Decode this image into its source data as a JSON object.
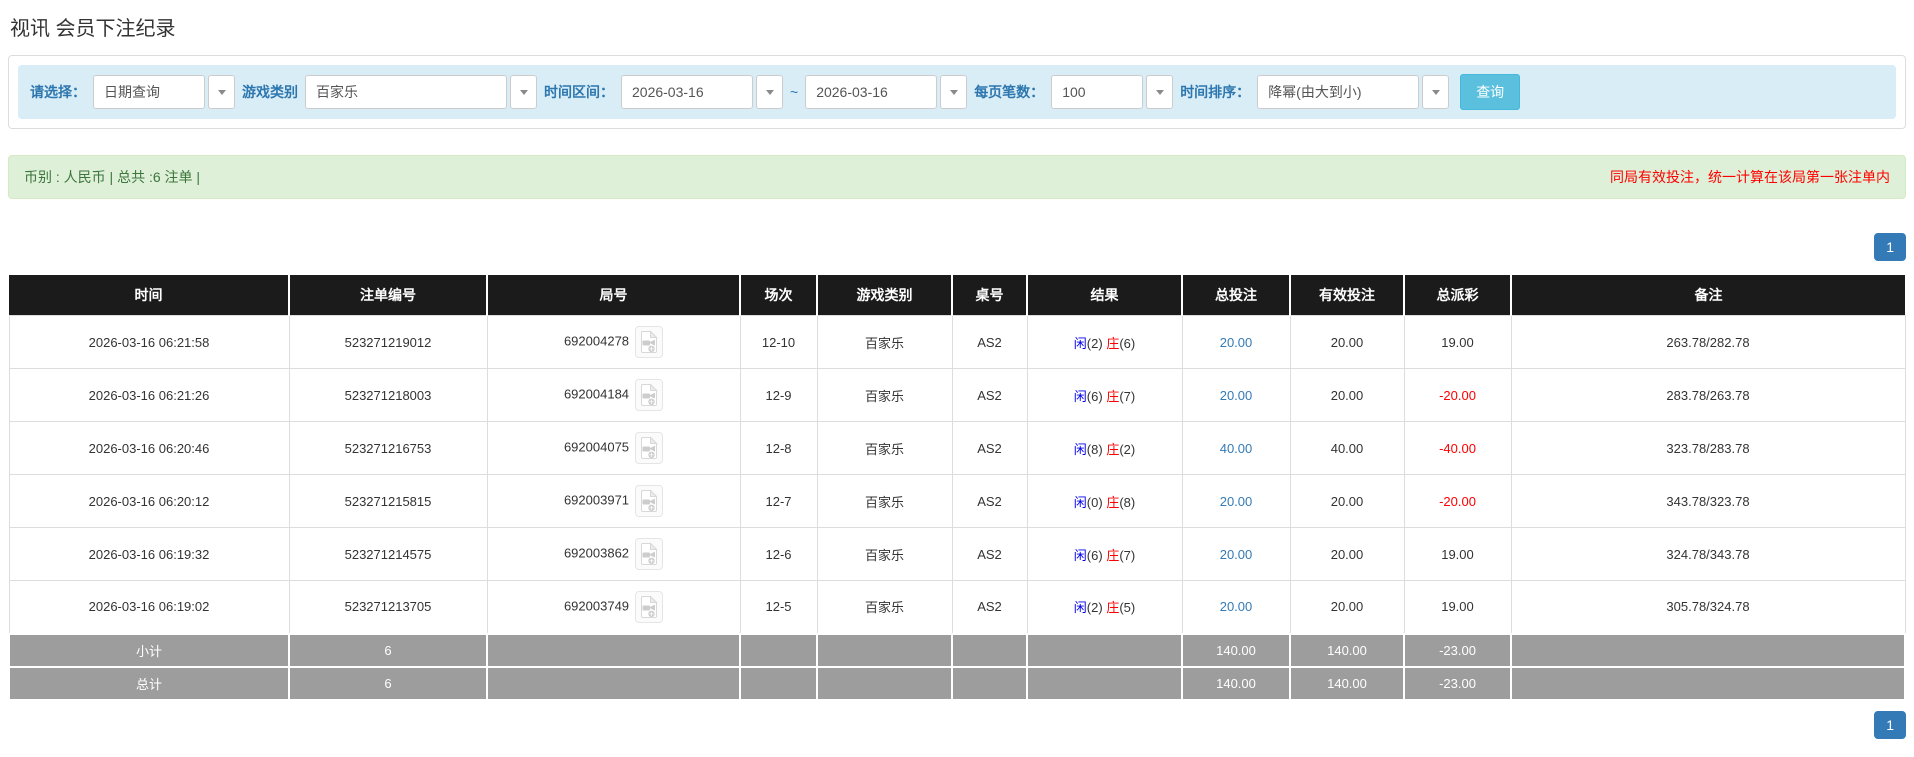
{
  "page_title": "视讯 会员下注纪录",
  "filters": {
    "select_label": "请选择：",
    "query_type": "日期查询",
    "game_category_label": "游戏类别",
    "game_category": "百家乐",
    "time_range_label": "时间区间：",
    "date_from": "2026-03-16",
    "tilde": "~",
    "date_to": "2026-03-16",
    "page_size_label": "每页笔数：",
    "page_size": "100",
    "sort_label": "时间排序：",
    "sort_value": "降幂(由大到小)",
    "search_button": "查询"
  },
  "summary_bar": {
    "left": "币别 : 人民币 | 总共 :6 注单 |",
    "right": "同局有效投注，统一计算在该局第一张注单内"
  },
  "pagination": {
    "page": "1"
  },
  "table": {
    "headers": [
      "时间",
      "注单编号",
      "局号",
      "场次",
      "游戏类别",
      "桌号",
      "结果",
      "总投注",
      "有效投注",
      "总派彩",
      "备注"
    ],
    "rows": [
      {
        "time": "2026-03-16 06:21:58",
        "bet_id": "523271219012",
        "round": "692004278",
        "session": "12-10",
        "game": "百家乐",
        "table_no": "AS2",
        "result": {
          "p": "闲",
          "pn": "(2)",
          "b": "庄",
          "bn": "(6)"
        },
        "total_bet": "20.00",
        "valid_bet": "20.00",
        "payout": "19.00",
        "remark": "263.78/282.78"
      },
      {
        "time": "2026-03-16 06:21:26",
        "bet_id": "523271218003",
        "round": "692004184",
        "session": "12-9",
        "game": "百家乐",
        "table_no": "AS2",
        "result": {
          "p": "闲",
          "pn": "(6)",
          "b": "庄",
          "bn": "(7)"
        },
        "total_bet": "20.00",
        "valid_bet": "20.00",
        "payout": "-20.00",
        "remark": "283.78/263.78"
      },
      {
        "time": "2026-03-16 06:20:46",
        "bet_id": "523271216753",
        "round": "692004075",
        "session": "12-8",
        "game": "百家乐",
        "table_no": "AS2",
        "result": {
          "p": "闲",
          "pn": "(8)",
          "b": "庄",
          "bn": "(2)"
        },
        "total_bet": "40.00",
        "valid_bet": "40.00",
        "payout": "-40.00",
        "remark": "323.78/283.78"
      },
      {
        "time": "2026-03-16 06:20:12",
        "bet_id": "523271215815",
        "round": "692003971",
        "session": "12-7",
        "game": "百家乐",
        "table_no": "AS2",
        "result": {
          "p": "闲",
          "pn": "(0)",
          "b": "庄",
          "bn": "(8)"
        },
        "total_bet": "20.00",
        "valid_bet": "20.00",
        "payout": "-20.00",
        "remark": "343.78/323.78"
      },
      {
        "time": "2026-03-16 06:19:32",
        "bet_id": "523271214575",
        "round": "692003862",
        "session": "12-6",
        "game": "百家乐",
        "table_no": "AS2",
        "result": {
          "p": "闲",
          "pn": "(6)",
          "b": "庄",
          "bn": "(7)"
        },
        "total_bet": "20.00",
        "valid_bet": "20.00",
        "payout": "19.00",
        "remark": "324.78/343.78"
      },
      {
        "time": "2026-03-16 06:19:02",
        "bet_id": "523271213705",
        "round": "692003749",
        "session": "12-5",
        "game": "百家乐",
        "table_no": "AS2",
        "result": {
          "p": "闲",
          "pn": "(2)",
          "b": "庄",
          "bn": "(5)"
        },
        "total_bet": "20.00",
        "valid_bet": "20.00",
        "payout": "19.00",
        "remark": "305.78/324.78"
      }
    ],
    "footer_rows": [
      {
        "label": "小计",
        "count": "6",
        "total_bet": "140.00",
        "valid_bet": "140.00",
        "payout": "-23.00"
      },
      {
        "label": "总计",
        "count": "6",
        "total_bet": "140.00",
        "valid_bet": "140.00",
        "payout": "-23.00"
      }
    ]
  },
  "icons": {
    "video_replay": "video-replay-icon",
    "dropdown": "chevron-down-icon"
  },
  "colors": {
    "header_bg": "#1b1b1b",
    "summary_row_bg": "#9d9d9d",
    "filter_bar_bg": "#d9edf7",
    "filter_label_blue": "#2e77ae",
    "success_bg": "#dff0d8",
    "success_text": "#3c763d",
    "danger_text": "#ff0000",
    "link_blue": "#337ab7",
    "player_blue": "#0000ee",
    "banker_red": "#ff0000",
    "search_button_bg": "#5bc0de",
    "pagination_active_bg": "#337ab7"
  }
}
